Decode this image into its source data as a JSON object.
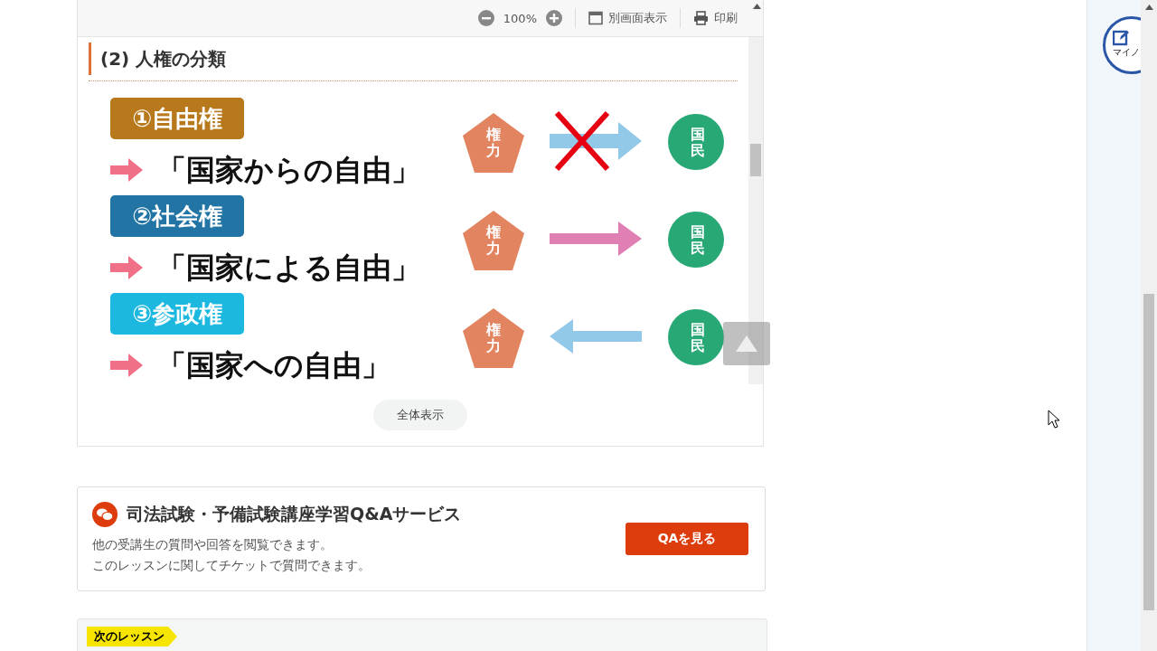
{
  "viewer": {
    "zoom": "100%",
    "new_window": "別画面表示",
    "print": "印刷",
    "heading": "(2) 人権の分類",
    "rows": [
      {
        "label": "①自由権",
        "color": "#b8791c",
        "phrase": "「国家からの自由」",
        "power": "権力",
        "people": "国民",
        "kind": "blocked"
      },
      {
        "label": "②社会権",
        "color": "#2274a5",
        "phrase": "「国家による自由」",
        "power": "権力",
        "people": "国民",
        "kind": "toward"
      },
      {
        "label": "③参政権",
        "color": "#1cb8e0",
        "phrase": "「国家への自由」",
        "power": "権力",
        "people": "国民",
        "kind": "back"
      }
    ],
    "show_all": "全体表示"
  },
  "qa": {
    "title": "司法試験・予備試験講座学習Q&Aサービス",
    "lines": [
      "他の受講生の質問や回答を閲覧できます。",
      "このレッスンに関してチケットで質問できます。"
    ],
    "button": "QAを見る"
  },
  "next": {
    "tag": "次のレッスン"
  },
  "side": {
    "note": "マイノ"
  }
}
